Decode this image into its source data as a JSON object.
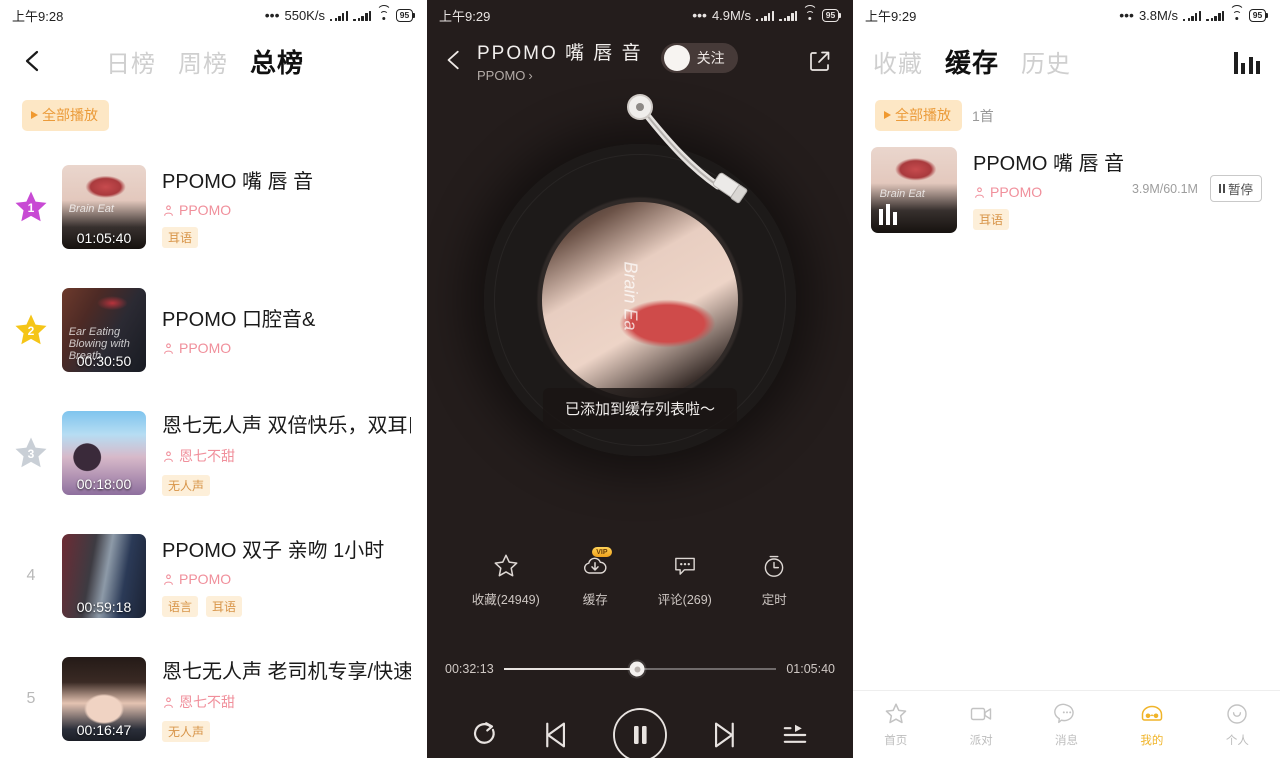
{
  "panel1": {
    "status": {
      "time": "上午9:28",
      "netspeed": "550K/s",
      "battery": "95"
    },
    "header": {
      "back_icon": "back-arrow-icon",
      "tabs": [
        {
          "label": "日榜",
          "active": false
        },
        {
          "label": "周榜",
          "active": false
        },
        {
          "label": "总榜",
          "active": true
        }
      ]
    },
    "play_all": {
      "label": "全部播放"
    },
    "tracks": [
      {
        "rank": "1",
        "rank_style": "star-purple",
        "title": "PPOMO 嘴 唇 音",
        "artist": "PPOMO",
        "duration": "01:05:40",
        "watermark": "Brain Eat",
        "tags": [
          "耳语"
        ]
      },
      {
        "rank": "2",
        "rank_style": "star-gold",
        "title": "PPOMO 口腔音&",
        "artist": "PPOMO",
        "duration": "00:30:50",
        "watermark": "Ear Eating Blowing with Breath",
        "tags": []
      },
      {
        "rank": "3",
        "rank_style": "star-gray",
        "title": "恩七无人声 双倍快乐，双耳口",
        "artist": "恩七不甜",
        "duration": "00:18:00",
        "watermark": "",
        "tags": [
          "无人声"
        ]
      },
      {
        "rank": "4",
        "rank_style": "plain",
        "title": "PPOMO 双子 亲吻 1小时",
        "artist": "PPOMO",
        "duration": "00:59:18",
        "watermark": "",
        "tags": [
          "语言",
          "耳语"
        ]
      },
      {
        "rank": "5",
        "rank_style": "plain",
        "title": "恩七无人声 老司机专享/快速",
        "artist": "恩七不甜",
        "duration": "00:16:47",
        "watermark": "",
        "tags": [
          "无人声"
        ]
      }
    ]
  },
  "panel2": {
    "status": {
      "time": "上午9:29",
      "netspeed": "4.9M/s",
      "battery": "95"
    },
    "header": {
      "back_icon": "back-arrow-icon",
      "title": "PPOMO 嘴 唇 音",
      "subtitle": "PPOMO",
      "subtitle_chevron": "›",
      "follow_label": "关注",
      "share_icon": "share-external-icon"
    },
    "cover_watermark": "Brain Ea",
    "toast": "已添加到缓存列表啦～",
    "actions": [
      {
        "icon": "star-outline-icon",
        "label": "收藏(24949)",
        "badge": ""
      },
      {
        "icon": "cloud-download-icon",
        "label": "缓存",
        "badge": "VIP"
      },
      {
        "icon": "comment-bubble-icon",
        "label": "评论(269)",
        "badge": ""
      },
      {
        "icon": "timer-clock-icon",
        "label": "定时",
        "badge": ""
      }
    ],
    "seek": {
      "current": "00:32:13",
      "total": "01:05:40",
      "percent": 49
    },
    "controls": [
      {
        "icon": "repeat-loop-icon",
        "name": "repeat-button"
      },
      {
        "icon": "previous-track-icon",
        "name": "previous-button"
      },
      {
        "icon": "pause-icon",
        "name": "play-pause-button"
      },
      {
        "icon": "next-track-icon",
        "name": "next-button"
      },
      {
        "icon": "playlist-queue-icon",
        "name": "playlist-button"
      }
    ]
  },
  "panel3": {
    "status": {
      "time": "上午9:29",
      "netspeed": "3.8M/s",
      "battery": "95"
    },
    "header": {
      "tabs": [
        {
          "label": "收藏",
          "active": false
        },
        {
          "label": "缓存",
          "active": true
        },
        {
          "label": "历史",
          "active": false
        }
      ],
      "eq_icon": "equalizer-bars-icon"
    },
    "play_all": {
      "label": "全部播放",
      "count": "1首"
    },
    "track": {
      "title": "PPOMO 嘴 唇 音",
      "artist": "PPOMO",
      "tags": [
        "耳语"
      ],
      "size": "3.9M/60.1M",
      "pause_label": "暂停",
      "watermark": "Brain Eat"
    },
    "bottom_nav": [
      {
        "label": "首页",
        "icon": "star-outline-icon",
        "active": false
      },
      {
        "label": "派对",
        "icon": "video-camera-icon",
        "active": false
      },
      {
        "label": "消息",
        "icon": "chat-bubble-icon",
        "active": false
      },
      {
        "label": "我的",
        "icon": "headset-vr-icon",
        "active": true
      },
      {
        "label": "个人",
        "icon": "person-circle-icon",
        "active": false
      }
    ]
  },
  "colors": {
    "accent_orange": "#f0992f",
    "tag_bg": "#fdefd9",
    "tag_text": "#d79448",
    "artist_pink": "#f08f9b",
    "star_purple": "#c84ad4",
    "star_gold": "#f5c518",
    "star_gray": "#c9cfd6",
    "dark_bg": "#241d1c"
  }
}
